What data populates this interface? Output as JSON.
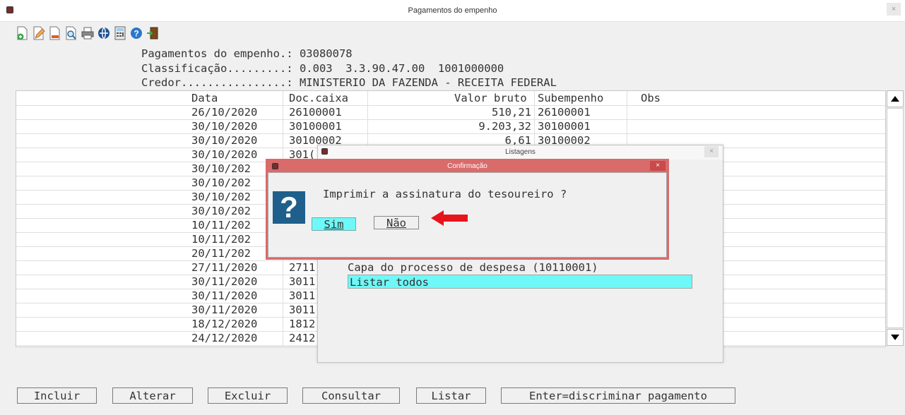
{
  "window": {
    "title": "Pagamentos do empenho",
    "close": "×"
  },
  "toolbar": [
    {
      "icon": "add-document-icon"
    },
    {
      "icon": "edit-document-icon"
    },
    {
      "icon": "delete-document-icon"
    },
    {
      "icon": "search-document-icon"
    },
    {
      "icon": "printer-icon"
    },
    {
      "icon": "globe-icon"
    },
    {
      "icon": "calculator-icon"
    },
    {
      "icon": "help-icon"
    },
    {
      "icon": "exit-door-icon"
    }
  ],
  "header": {
    "empenho_label": "Pagamentos do empenho.: ",
    "empenho_value": "03080078",
    "classificacao_label": "Classificação.........: ",
    "classificacao_value": "0.003  3.3.90.47.00  1001000000",
    "credor_label": "Credor................: ",
    "credor_value": "MINISTERIO DA FAZENDA - RECEITA FEDERAL"
  },
  "table": {
    "columns": [
      "Data",
      "Doc.caixa",
      "Valor bruto",
      "Subempenho",
      "Obs"
    ],
    "rows": [
      [
        "26/10/2020",
        "26100001",
        "510,21",
        "26100001"
      ],
      [
        "30/10/2020",
        "30100001",
        "9.203,32",
        "30100001"
      ],
      [
        "30/10/2020",
        "30100002",
        "6,61",
        "30100002"
      ],
      [
        "30/10/2020",
        "301(",
        "",
        ""
      ],
      [
        "30/10/202",
        "",
        "",
        ""
      ],
      [
        "30/10/202",
        "",
        "",
        ""
      ],
      [
        "30/10/202",
        "",
        "",
        ""
      ],
      [
        "30/10/202",
        "",
        "",
        ""
      ],
      [
        "10/11/202",
        "",
        "",
        ""
      ],
      [
        "10/11/202",
        "",
        "",
        ""
      ],
      [
        "20/11/202",
        "",
        "",
        ""
      ],
      [
        "27/11/2020",
        "2711",
        "",
        ""
      ],
      [
        "30/11/2020",
        "3011",
        "",
        ""
      ],
      [
        "30/11/2020",
        "3011",
        "",
        ""
      ],
      [
        "30/11/2020",
        "3011",
        "",
        ""
      ],
      [
        "18/12/2020",
        "1812",
        "",
        ""
      ],
      [
        "24/12/2020",
        "2412",
        "",
        ""
      ]
    ]
  },
  "listagens": {
    "title": "Listagens",
    "close": "×",
    "item1": "Capa do processo de despesa (10110001)",
    "item2": "Listar todos"
  },
  "confirm": {
    "title": "Confirmação",
    "close": "×",
    "question": "Imprimir a assinatura do tesoureiro ?",
    "icon_glyph": "?",
    "yes": "Sim",
    "no": "Não"
  },
  "buttons": {
    "incluir": "Incluir",
    "alterar": "Alterar",
    "excluir": "Excluir",
    "consultar": "Consultar",
    "listar": "Listar",
    "discriminar": "Enter=discriminar pagamento"
  },
  "colors": {
    "highlight": "#6ef8f8",
    "dialog_border": "#d96b6b",
    "arrow": "#e8141c",
    "question_icon": "#1f5f8b"
  }
}
